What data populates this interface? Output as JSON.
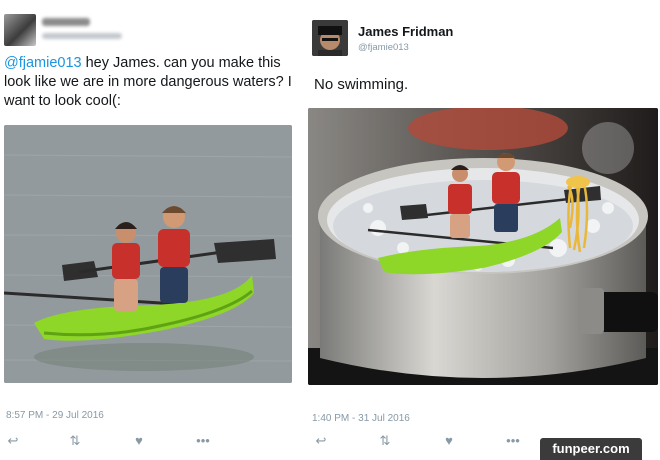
{
  "left_tweet": {
    "mention": "@fjamie013",
    "text": " hey James. can you make this look like we are in more dangerous waters? I want to look cool(:",
    "timestamp": "8:57 PM - 29 Jul 2016",
    "photo": {
      "subject": "two girls paddling a green kayak on a lake"
    }
  },
  "right_tweet": {
    "display_name": "James Fridman",
    "handle": "@fjamie013",
    "text": "No swimming.",
    "timestamp": "1:40 PM - 31 Jul 2016",
    "photo": {
      "subject": "kayak photoshopped into a boiling pot of pasta"
    }
  },
  "actions": {
    "reply_icon": "reply-icon",
    "retweet_icon": "retweet-icon",
    "like_icon": "heart-icon",
    "more_icon": "more-icon"
  },
  "watermark": "funpeer.com",
  "colors": {
    "link": "#1b95e0",
    "meta": "#8899a6",
    "kayak": "#7ed321"
  }
}
